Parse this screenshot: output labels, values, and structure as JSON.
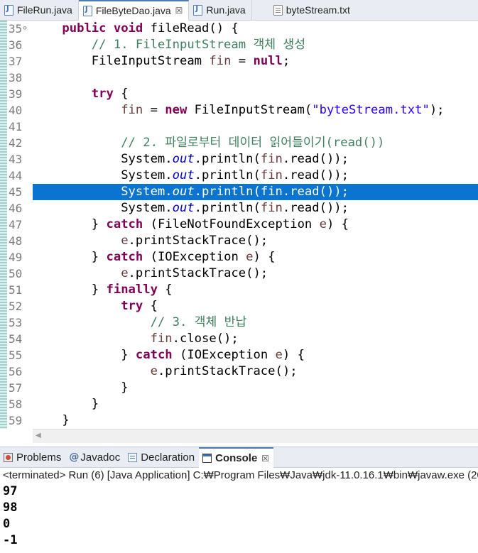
{
  "editor_tabs": [
    {
      "label": "FileRun.java"
    },
    {
      "label": "FileByteDao.java",
      "close": "☒"
    },
    {
      "label": "Run.java"
    },
    {
      "label": "byteStream.txt"
    }
  ],
  "line_numbers": [
    "35",
    "36",
    "37",
    "38",
    "39",
    "40",
    "41",
    "42",
    "43",
    "44",
    "45",
    "46",
    "47",
    "48",
    "49",
    "50",
    "51",
    "52",
    "53",
    "54",
    "55",
    "56",
    "57",
    "58",
    "59"
  ],
  "code": {
    "kw_public": "public",
    "kw_void": "void",
    "method_fileRead": " fileRead() {",
    "comment_1": "// 1. FileInputStream 객체 생성",
    "type_FileInputStream": "FileInputStream",
    "var_fin": "fin",
    "assign": " = ",
    "kw_null": "null",
    "semicolon": ";",
    "kw_try": "try",
    "brace_open": " {",
    "kw_new": "new",
    "new_stream_open": " FileInputStream(",
    "str_filename": "\"byteStream.txt\"",
    "close_paren_semi": ");",
    "comment_2": "// 2. 파일로부터 데이터 읽어들이기(read())",
    "sys": "System.",
    "fld_out": "out",
    "println_open": ".println(",
    "read_close": ".read());",
    "brace_close": "}",
    "kw_catch": "catch",
    "catch_fnf_open": " (FileNotFoundException ",
    "var_e": "e",
    "catch_close": ") {",
    "print_stack": ".printStackTrace();",
    "catch_io_open": " (IOException ",
    "kw_finally": "finally",
    "comment_3": "// 3. 객체 반납",
    "close_call": ".close();"
  },
  "bottom_tabs": {
    "problems": "Problems",
    "javadoc": "Javadoc",
    "javadoc_glyph": "@",
    "declaration": "Declaration",
    "console": "Console",
    "console_close": "☒"
  },
  "console_status": "<terminated> Run (6) [Java Application] C:₩Program Files₩Java₩jdk-11.0.16.1₩bin₩javaw.exe  (20",
  "console_output": [
    "97",
    "98",
    "0",
    "-1"
  ],
  "colors": {
    "keyword": "#7f0055",
    "comment": "#3f7f5f",
    "string": "#2a00ff",
    "field": "#0000c0",
    "selection": "#0a74d0"
  }
}
